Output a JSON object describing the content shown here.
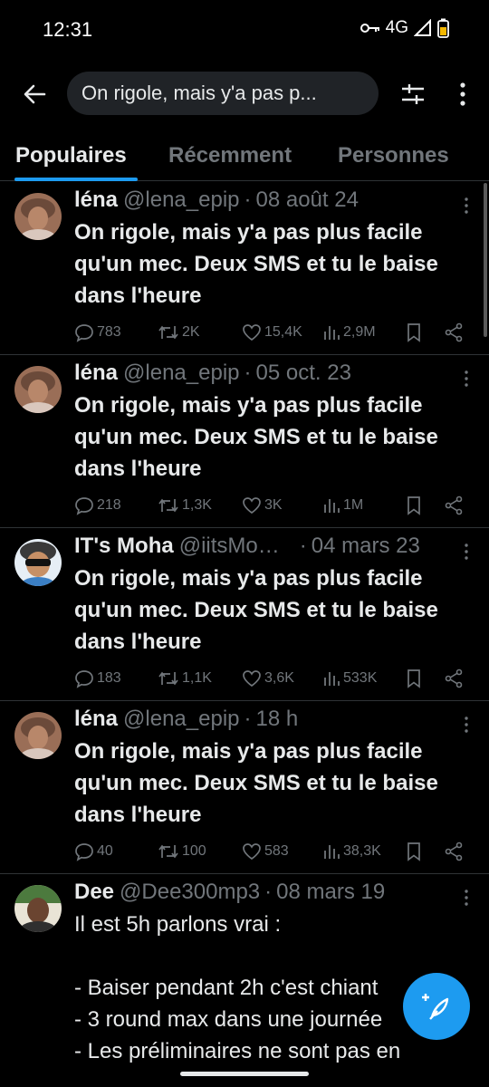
{
  "status_bar": {
    "time": "12:31",
    "network": "4G",
    "icons": [
      "key-icon",
      "signal-icon",
      "battery-icon"
    ]
  },
  "search": {
    "query": "On rigole, mais y'a pas p..."
  },
  "tabs": [
    {
      "label": "Populaires",
      "active": true
    },
    {
      "label": "Récemment",
      "active": false
    },
    {
      "label": "Personnes",
      "active": false
    }
  ],
  "tweets": [
    {
      "name": "léna",
      "handle": "@lena_epip",
      "date": "08 août 24",
      "text": "On rigole, mais y'a pas plus facile qu'un mec. Deux SMS et tu le baise dans l'heure",
      "replies": "783",
      "reposts": "2K",
      "likes": "15,4K",
      "views": "2,9M"
    },
    {
      "name": "léna",
      "handle": "@lena_epip",
      "date": "05 oct. 23",
      "text": "On rigole, mais y'a pas plus facile qu'un mec. Deux SMS et tu le baise dans l'heure",
      "replies": "218",
      "reposts": "1,3K",
      "likes": "3K",
      "views": "1M"
    },
    {
      "name": "IT's Moha",
      "handle": "@iitsMo…",
      "date": "04 mars 23",
      "text": "On rigole, mais y'a pas plus facile qu'un mec. Deux SMS et tu le baise dans l'heure",
      "replies": "183",
      "reposts": "1,1K",
      "likes": "3,6K",
      "views": "533K"
    },
    {
      "name": "léna",
      "handle": "@lena_epip",
      "date": "18 h",
      "text": "On rigole, mais y'a pas plus facile qu'un mec. Deux SMS et tu le baise dans l'heure",
      "replies": "40",
      "reposts": "100",
      "likes": "583",
      "views": "38,3K"
    },
    {
      "name": "Dee",
      "handle": "@Dee300mp3",
      "date": "08 mars 19",
      "lines": [
        "Il est 5h parlons vrai :",
        "",
        "- Baiser pendant 2h c'est chiant",
        "- 3 round max dans une journée",
        "- Les préliminaires ne sont pas en"
      ]
    }
  ],
  "colors": {
    "accent": "#1d9bf0",
    "muted": "#71767b",
    "text": "#e7e9ea",
    "divider": "#2f3336"
  }
}
